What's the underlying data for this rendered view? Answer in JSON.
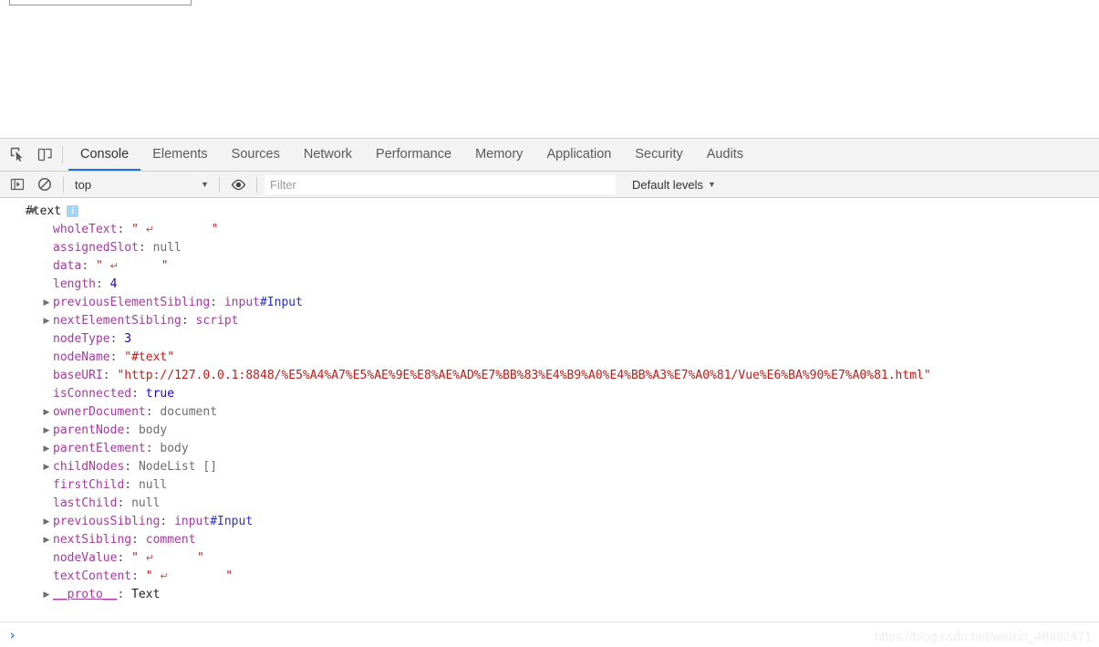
{
  "page": {
    "input_value": "",
    "input_placeholder": ""
  },
  "devtools": {
    "toolbar_icons": [
      {
        "name": "inspect-element-icon",
        "title": "Inspect"
      },
      {
        "name": "device-toolbar-icon",
        "title": "Toggle device toolbar"
      }
    ],
    "tabs": [
      {
        "label": "Console",
        "active": true
      },
      {
        "label": "Elements",
        "active": false
      },
      {
        "label": "Sources",
        "active": false
      },
      {
        "label": "Network",
        "active": false
      },
      {
        "label": "Performance",
        "active": false
      },
      {
        "label": "Memory",
        "active": false
      },
      {
        "label": "Application",
        "active": false
      },
      {
        "label": "Security",
        "active": false
      },
      {
        "label": "Audits",
        "active": false
      }
    ],
    "filterbar": {
      "sidebar_toggle_icon": "console-sidebar-icon",
      "clear_icon": "clear-console-icon",
      "context_value": "top",
      "context_caret": "▼",
      "eye_icon": "live-expression-eye-icon",
      "filter_placeholder": "Filter",
      "filter_value": "",
      "levels_label": "Default levels",
      "levels_caret": "▼"
    },
    "prompt": {
      "caret": "›",
      "value": "",
      "placeholder": ""
    }
  },
  "console_output": {
    "root": {
      "arrow": "▼",
      "label": "#text",
      "badge": "i"
    },
    "properties": [
      {
        "arrow": "",
        "key": "wholeText",
        "sep": ": ",
        "value": "\" ↵        \"",
        "vtype": "str-crlf"
      },
      {
        "arrow": "",
        "key": "assignedSlot",
        "sep": ": ",
        "value": "null",
        "vtype": "null"
      },
      {
        "arrow": "",
        "key": "data",
        "sep": ": ",
        "value": "\" ↵      \"",
        "vtype": "str-crlf"
      },
      {
        "arrow": "",
        "key": "length",
        "sep": ": ",
        "value": "4",
        "vtype": "num"
      },
      {
        "arrow": "▶",
        "key": "previousElementSibling",
        "sep": ": ",
        "value": "input#Input",
        "vtype": "node-id"
      },
      {
        "arrow": "▶",
        "key": "nextElementSibling",
        "sep": ": ",
        "value": "script",
        "vtype": "node"
      },
      {
        "arrow": "",
        "key": "nodeType",
        "sep": ": ",
        "value": "3",
        "vtype": "num"
      },
      {
        "arrow": "",
        "key": "nodeName",
        "sep": ": ",
        "value": "\"#text\"",
        "vtype": "str"
      },
      {
        "arrow": "",
        "key": "baseURI",
        "sep": ": ",
        "value": "\"http://127.0.0.1:8848/%E5%A4%A7%E5%AE%9E%E8%AE%AD%E7%BB%83%E4%B9%A0%E4%BB%A3%E7%A0%81/Vue%E6%BA%90%E7%A0%81.html\"",
        "vtype": "str"
      },
      {
        "arrow": "",
        "key": "isConnected",
        "sep": ": ",
        "value": "true",
        "vtype": "kw"
      },
      {
        "arrow": "▶",
        "key": "ownerDocument",
        "sep": ": ",
        "value": "document",
        "vtype": "grey"
      },
      {
        "arrow": "▶",
        "key": "parentNode",
        "sep": ": ",
        "value": "body",
        "vtype": "grey"
      },
      {
        "arrow": "▶",
        "key": "parentElement",
        "sep": ": ",
        "value": "body",
        "vtype": "grey"
      },
      {
        "arrow": "▶",
        "key": "childNodes",
        "sep": ": ",
        "value": "NodeList []",
        "vtype": "grey"
      },
      {
        "arrow": "",
        "key": "firstChild",
        "sep": ": ",
        "value": "null",
        "vtype": "null"
      },
      {
        "arrow": "",
        "key": "lastChild",
        "sep": ": ",
        "value": "null",
        "vtype": "null"
      },
      {
        "arrow": "▶",
        "key": "previousSibling",
        "sep": ": ",
        "value": "input#Input",
        "vtype": "node-id"
      },
      {
        "arrow": "▶",
        "key": "nextSibling",
        "sep": ": ",
        "value": "comment",
        "vtype": "node"
      },
      {
        "arrow": "",
        "key": "nodeValue",
        "sep": ": ",
        "value": "\" ↵      \"",
        "vtype": "str-crlf"
      },
      {
        "arrow": "",
        "key": "textContent",
        "sep": ": ",
        "value": "\" ↵        \"",
        "vtype": "str-crlf"
      },
      {
        "arrow": "▶",
        "key": "__proto__",
        "sep": ": ",
        "value": "Text",
        "vtype": "proto"
      }
    ]
  },
  "watermark": {
    "text": "https://blog.csdn.net/weixin_48882471"
  },
  "colors": {
    "accent": "#1a73e8",
    "toolbar_bg": "#f3f3f3",
    "border": "#cdcdcd",
    "key": "#a33b9e",
    "string": "#c41a16",
    "number": "#1c00cf",
    "grey": "#6e6e6e"
  }
}
